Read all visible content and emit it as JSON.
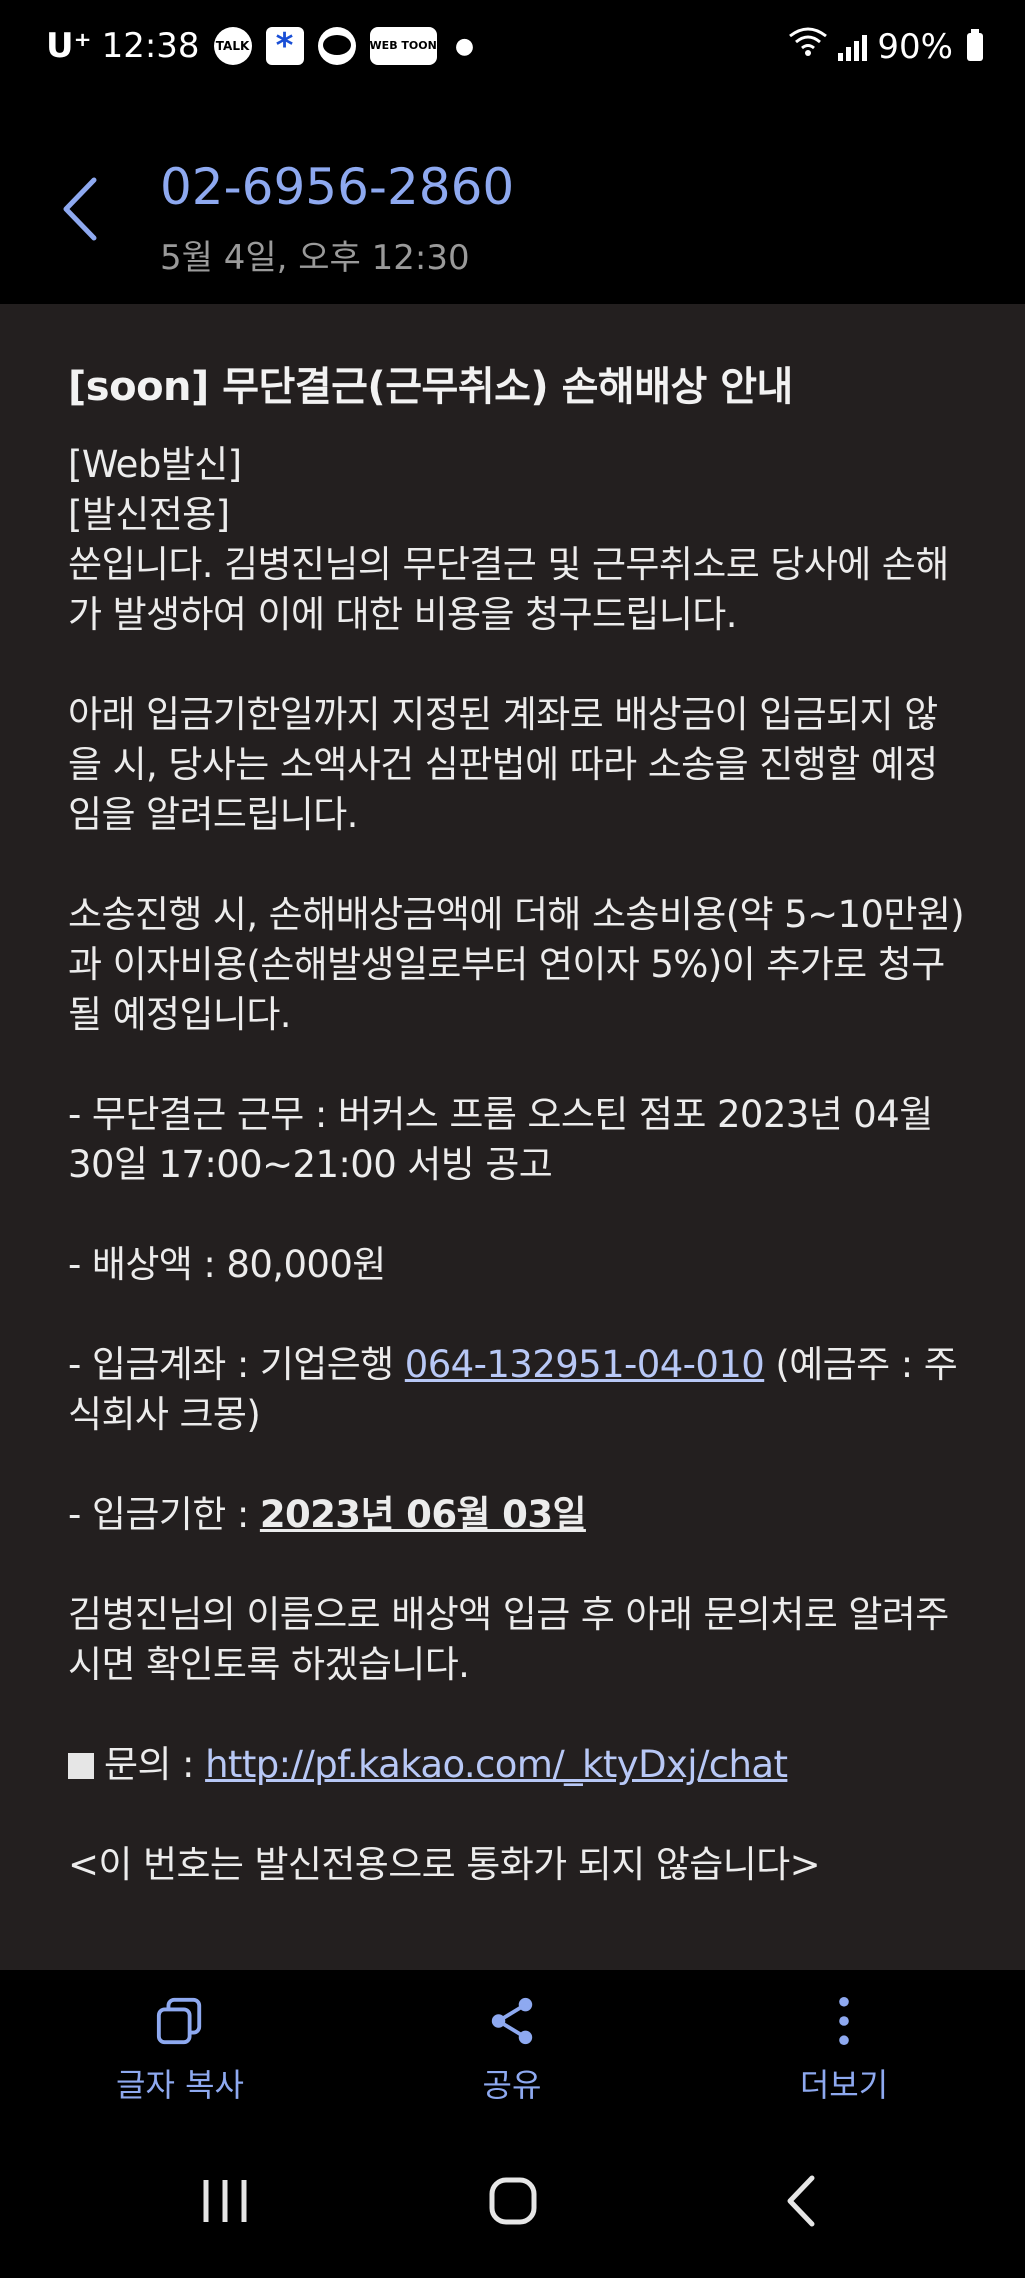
{
  "status_bar": {
    "carrier": "U⁺",
    "time": "12:38",
    "notif_icons": [
      "TALK",
      "*",
      "WEB TOON"
    ],
    "battery": "90%"
  },
  "header": {
    "sender_number": "02-6956-2860",
    "timestamp": "5월 4일, 오후 12:30"
  },
  "message": {
    "title": "[soon] 무단결근(근무취소) 손해배상 안내",
    "line1": "[Web발신]",
    "line2": "[발신전용]",
    "para1": "쑨입니다. 김병진님의 무단결근 및 근무취소로 당사에 손해가 발생하여 이에 대한 비용을 청구드립니다.",
    "para2": "아래 입금기한일까지 지정된 계좌로 배상금이 입금되지 않을 시, 당사는 소액사건 심판법에 따라 소송을 진행할 예정임을 알려드립니다.",
    "para3": "소송진행 시, 손해배상금액에 더해 소송비용(약 5~10만원)과 이자비용(손해발생일로부터 연이자 5%)이 추가로 청구될 예정입니다.",
    "work_item": "- 무단결근 근무 :  버커스 프롬 오스틴 점포 2023년 04월 30일 17:00~21:00 서빙 공고",
    "amount_item": "- 배상액 : 80,000원",
    "account_prefix": "- 입금계좌 : 기업은행 ",
    "account_number": "064-132951-04-010",
    "account_suffix": " (예금주 : 주식회사 크몽)",
    "deadline_prefix": "- 입금기한 : ",
    "deadline_date": "2023년 06월 03일",
    "para4": "김병진님의 이름으로 배상액 입금 후 아래 문의처로 알려주시면 확인토록 하겠습니다.",
    "inquiry_prefix": "문의 : ",
    "inquiry_link": "http://pf.kakao.com/_ktyDxj/chat",
    "footer_note": "<이 번호는 발신전용으로 통화가 되지 않습니다>"
  },
  "actions": {
    "copy_label": "글자 복사",
    "share_label": "공유",
    "more_label": "더보기"
  },
  "colors": {
    "accent": "#8ea9f0",
    "message_bg": "#231f1f",
    "link": "#b8c8f6"
  }
}
